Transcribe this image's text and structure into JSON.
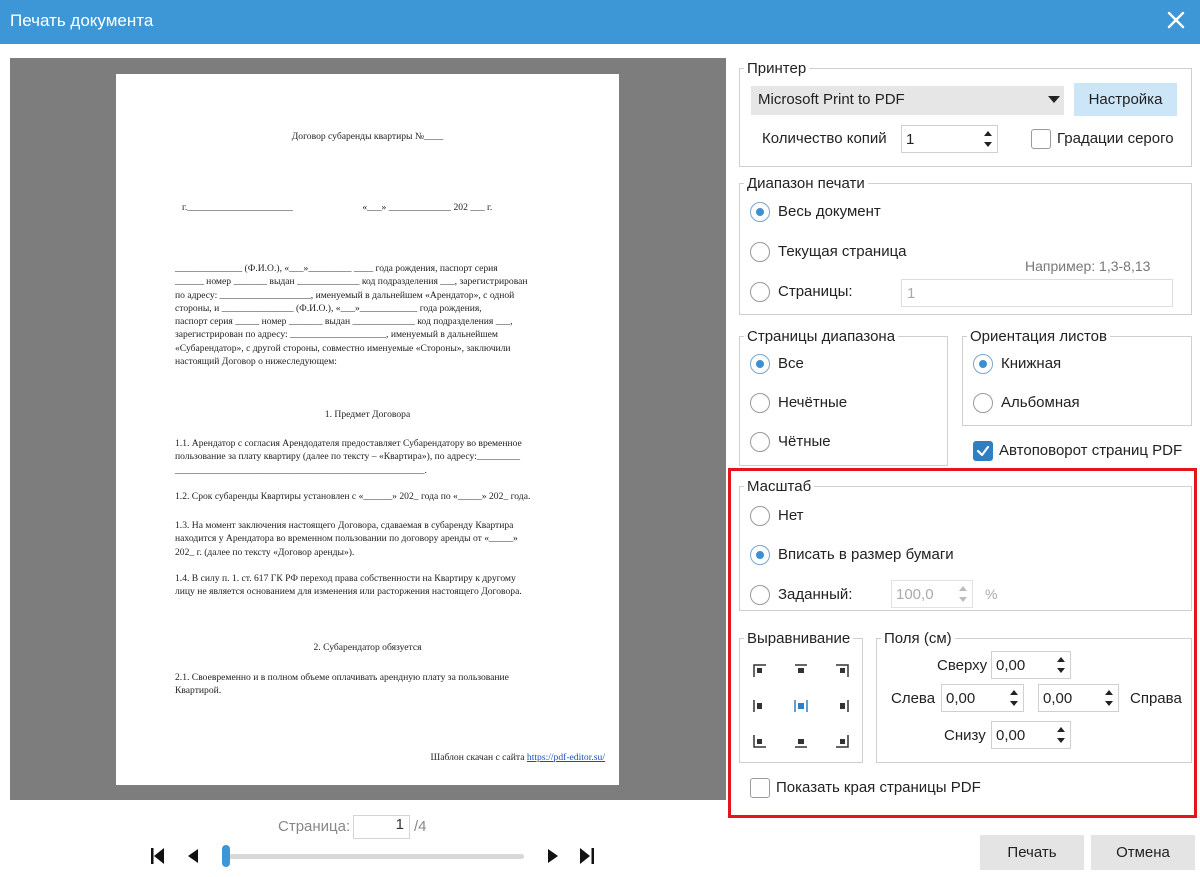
{
  "window": {
    "title": "Печать документа"
  },
  "document_preview": {
    "title": "Договор субаренды квартиры №____",
    "city_date": "г.______________________                             «___» _____________ 202 ___ г.",
    "intro": "______________ (Ф.И.О.), «___»_________ ____ года рождения, паспорт серия\n______ номер _______ выдан _____________ код подразделения ___, зарегистрирован\nпо адресу: ___________________, именуемый в дальнейшем «Арендатор», с одной\nстороны, и _______________ (Ф.И.О.), «___»____________ года рождения,\nпаспорт серия _____ номер _______ выдан _____________ код подразделения ___,\nзарегистрирован по адресу: ____________________, именуемый в дальнейшем\n«Субарендатор», с другой стороны, совместно именуемые «Стороны», заключили\nнастоящий Договор о нижеследующем:",
    "section1": "1. Предмет Договора",
    "p11": "1.1. Арендатор с согласия Арендодателя предоставляет Субарендатору во временное\nпользование за плату квартиру (далее по тексту – «Квартира»), по адресу:_________\n____________________________________________________.",
    "p12": "1.2. Срок субаренды Квартиры установлен с «______» 202_ года по «_____» 202_ года.",
    "p13": "1.3. На момент заключения настоящего Договора, сдаваемая в субаренду Квартира\nнаходится у Арендатора во временном пользовании по договору аренды от «_____»\n202_ г. (далее по тексту «Договор аренды»).",
    "p14": "1.4. В силу п. 1. ст. 617 ГК РФ переход права собственности на Квартиру к другому\nлицу не является основанием для изменения или расторжения настоящего Договора.",
    "section2": "2. Субарендатор обязуется",
    "p21": "2.1. Своевременно и в полном объеме оплачивать арендную плату за пользование\nКвартирой.",
    "credit_text": "Шаблон скачан с сайта ",
    "credit_link": "https://pdf-editor.su/"
  },
  "navigation": {
    "page_label": "Страница:",
    "current_page": "1",
    "total": "/4",
    "slider_position": 0.0
  },
  "printer": {
    "legend": "Принтер",
    "selected": "Microsoft Print to PDF",
    "setup_button": "Настройка",
    "copies_label": "Количество копий",
    "copies_value": "1",
    "grayscale_label": "Градации серого",
    "grayscale_checked": false
  },
  "range": {
    "legend": "Диапазон печати",
    "options": [
      "Весь документ",
      "Текущая страница",
      "Страницы:"
    ],
    "selected": 0,
    "hint": "Например: 1,3-8,13",
    "pages_value": "1"
  },
  "range_pages": {
    "legend": "Страницы диапазона",
    "options": [
      "Все",
      "Нечётные",
      "Чётные"
    ],
    "selected": 0
  },
  "orientation": {
    "legend": "Ориентация листов",
    "options": [
      "Книжная",
      "Альбомная"
    ],
    "selected": 0,
    "autorotate_label": "Автоповорот страниц PDF",
    "autorotate_checked": true
  },
  "scale": {
    "legend": "Масштаб",
    "options": [
      "Нет",
      "Вписать в размер бумаги",
      "Заданный:"
    ],
    "selected": 1,
    "custom_value": "100,0",
    "unit": "%"
  },
  "alignment": {
    "legend": "Выравнивание",
    "selected": "middle-center"
  },
  "margins": {
    "legend": "Поля (см)",
    "top_label": "Сверху",
    "top": "0,00",
    "left_label": "Слева",
    "left": "0,00",
    "right_label": "Справа",
    "right": "0,00",
    "bottom_label": "Снизу",
    "bottom": "0,00"
  },
  "show_edges": {
    "label": "Показать края страницы PDF",
    "checked": false
  },
  "actions": {
    "print": "Печать",
    "cancel": "Отмена"
  },
  "colors": {
    "titlebar": "#3d96d6",
    "accent": "#2e7fc4",
    "highlight_border": "#e3141b"
  }
}
